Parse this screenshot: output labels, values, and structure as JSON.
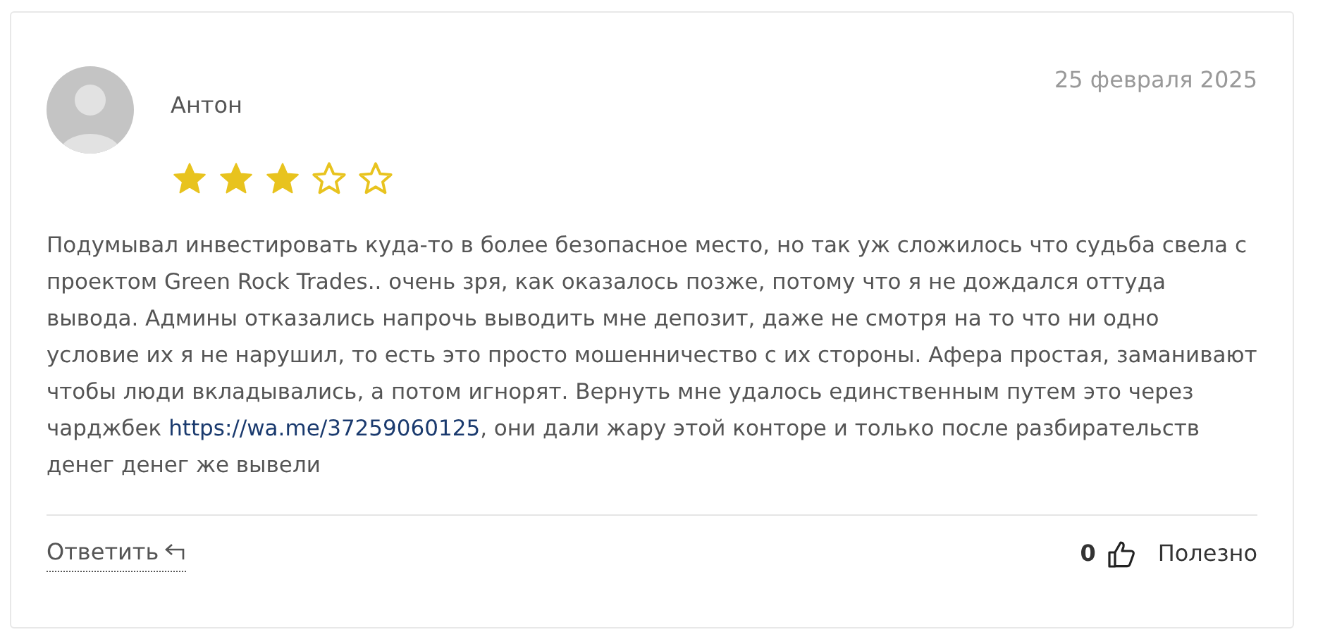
{
  "review": {
    "author": "Антон",
    "date": "25 февраля 2025",
    "stars": 3,
    "text_before": "Подумывал инвестировать куда-то в более безопасное место, но так уж сложилось что судьба свела с проектом Green Rock Trades.. очень зря, как оказалось позже, потому что я не дождался оттуда вывода. Админы отказались напрочь выводить мне депозит, даже не смотря на то что ни одно условие их я не нарушил, то есть это просто мошенничество с их стороны. Афера простая, заманивают чтобы люди вкладывались, а потом игнорят. Вернуть мне удалось единственным путем это через чарджбек ",
    "link": "https://wa.me/37259060125",
    "text_after": ", они дали жару этой конторе и только после разбирательств денег денег же вывели",
    "reply": "Ответить",
    "helpful_count": "0",
    "helpful": "Полезно"
  }
}
